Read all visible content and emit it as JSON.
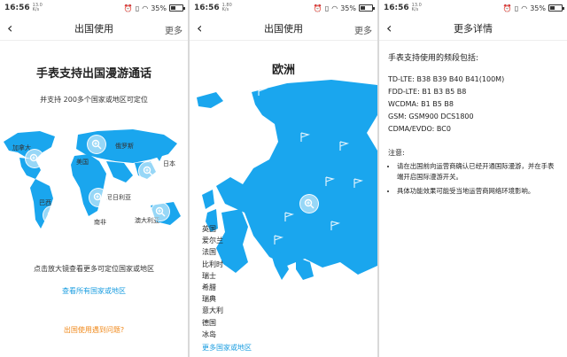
{
  "status_bar": {
    "time": "16:56",
    "speed_top": "13.0",
    "speed_bottom": "K/s",
    "speed_top_2": "1.80",
    "battery": "35%"
  },
  "screen1": {
    "nav_title": "出国使用",
    "nav_more": "更多",
    "headline": "手表支持出国漫游通话",
    "subline": "并支持 200多个国家或地区可定位",
    "map_labels": [
      "加拿大",
      "美国",
      "俄罗斯",
      "日本",
      "巴西",
      "南非",
      "尼日利亚",
      "澳大利亚"
    ],
    "hint": "点击放大镜查看更多可定位国家或地区",
    "view_all_link": "查看所有国家或地区",
    "problem_link": "出国使用遇到问题?"
  },
  "screen2": {
    "nav_title": "出国使用",
    "nav_more": "更多",
    "region_title": "欧洲",
    "countries": [
      "英国",
      "爱尔兰",
      "法国",
      "比利时",
      "瑞士",
      "希腊",
      "瑞典",
      "意大利",
      "德国",
      "冰岛"
    ],
    "more_link": "更多国家或地区"
  },
  "screen3": {
    "nav_title": "更多详情",
    "bands_heading": "手表支持使用的频段包括:",
    "bands": [
      "TD-LTE:  B38 B39 B40 B41(100M)",
      "FDD-LTE:  B1 B3 B5 B8",
      "WCDMA:  B1 B5 B8",
      "GSM:  GSM900  DCS1800",
      "CDMA/EVDO:  BC0"
    ],
    "note_title": "注意:",
    "notes": [
      "请在出国前向运营商确认已经开通国际漫游，并在手表端开启国际漫游开关。",
      "具体功能效果可能受当地运营商网络环境影响。"
    ]
  },
  "colors": {
    "map_blue": "#1aa6ee",
    "link_blue": "#1a9de0",
    "orange": "#f08a1c"
  }
}
